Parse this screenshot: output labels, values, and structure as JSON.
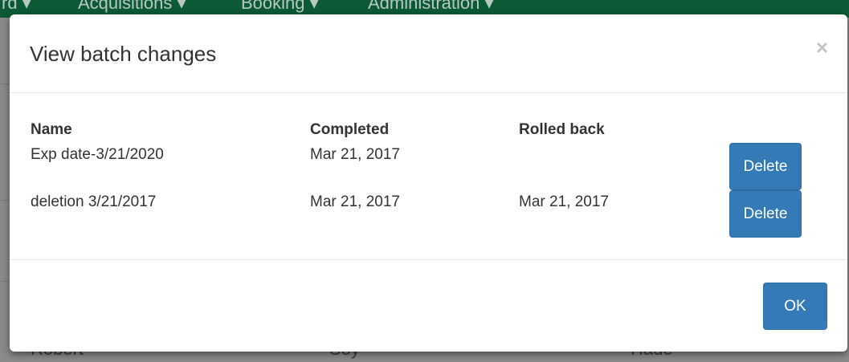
{
  "background": {
    "nav_items": [
      "rd ▾",
      "Acquisitions ▾",
      "Booking ▾",
      "Administration ▾"
    ],
    "row_texts": [
      "Robert",
      "Soy",
      "Hade"
    ]
  },
  "modal": {
    "title": "View batch changes",
    "close_label": "×",
    "table": {
      "headers": {
        "name": "Name",
        "completed": "Completed",
        "rolled_back": "Rolled back"
      },
      "rows": [
        {
          "name": "Exp date-3/21/2020",
          "completed": "Mar 21, 2017",
          "rolled_back": "",
          "action": "Delete"
        },
        {
          "name": "deletion 3/21/2017",
          "completed": "Mar 21, 2017",
          "rolled_back": "Mar 21, 2017",
          "action": "Delete"
        }
      ]
    },
    "footer": {
      "ok_label": "OK"
    }
  },
  "colors": {
    "primary": "#337ab7",
    "navbar": "#0b5a35"
  }
}
